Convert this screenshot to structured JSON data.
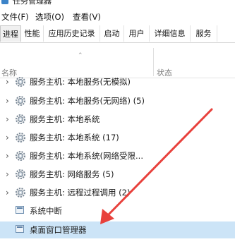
{
  "window": {
    "title": "任务管理器"
  },
  "menu": [
    {
      "label": "文件(F)"
    },
    {
      "label": "选项(O)"
    },
    {
      "label": "查看(V)"
    }
  ],
  "tabs": [
    {
      "label": "进程",
      "active": true
    },
    {
      "label": "性能"
    },
    {
      "label": "应用历史记录"
    },
    {
      "label": "启动"
    },
    {
      "label": "用户"
    },
    {
      "label": "详细信息"
    },
    {
      "label": "服务"
    }
  ],
  "columns": {
    "name": "名称",
    "status": "状态"
  },
  "rows": [
    {
      "label": "服务主机: 本地服务(无模拟)",
      "icon": "gear-icon",
      "expandable": true
    },
    {
      "label": "服务主机: 本地服务(无网络) (5)",
      "icon": "gear-icon",
      "expandable": true
    },
    {
      "label": "服务主机: 本地系统",
      "icon": "gear-icon",
      "expandable": true
    },
    {
      "label": "服务主机: 本地系统 (17)",
      "icon": "gear-icon",
      "expandable": true
    },
    {
      "label": "服务主机: 本地系统(网络受限...",
      "icon": "gear-icon",
      "expandable": true
    },
    {
      "label": "服务主机: 网络服务 (5)",
      "icon": "gear-icon",
      "expandable": true
    },
    {
      "label": "服务主机: 远程过程调用 (2)",
      "icon": "gear-icon",
      "expandable": true
    },
    {
      "label": "系统中断",
      "icon": "process-icon",
      "expandable": false
    },
    {
      "label": "桌面窗口管理器",
      "icon": "process-icon",
      "expandable": false,
      "selected": true
    }
  ],
  "colors": {
    "annotation_arrow": "#e8413c",
    "selection": "#cce4f7"
  }
}
